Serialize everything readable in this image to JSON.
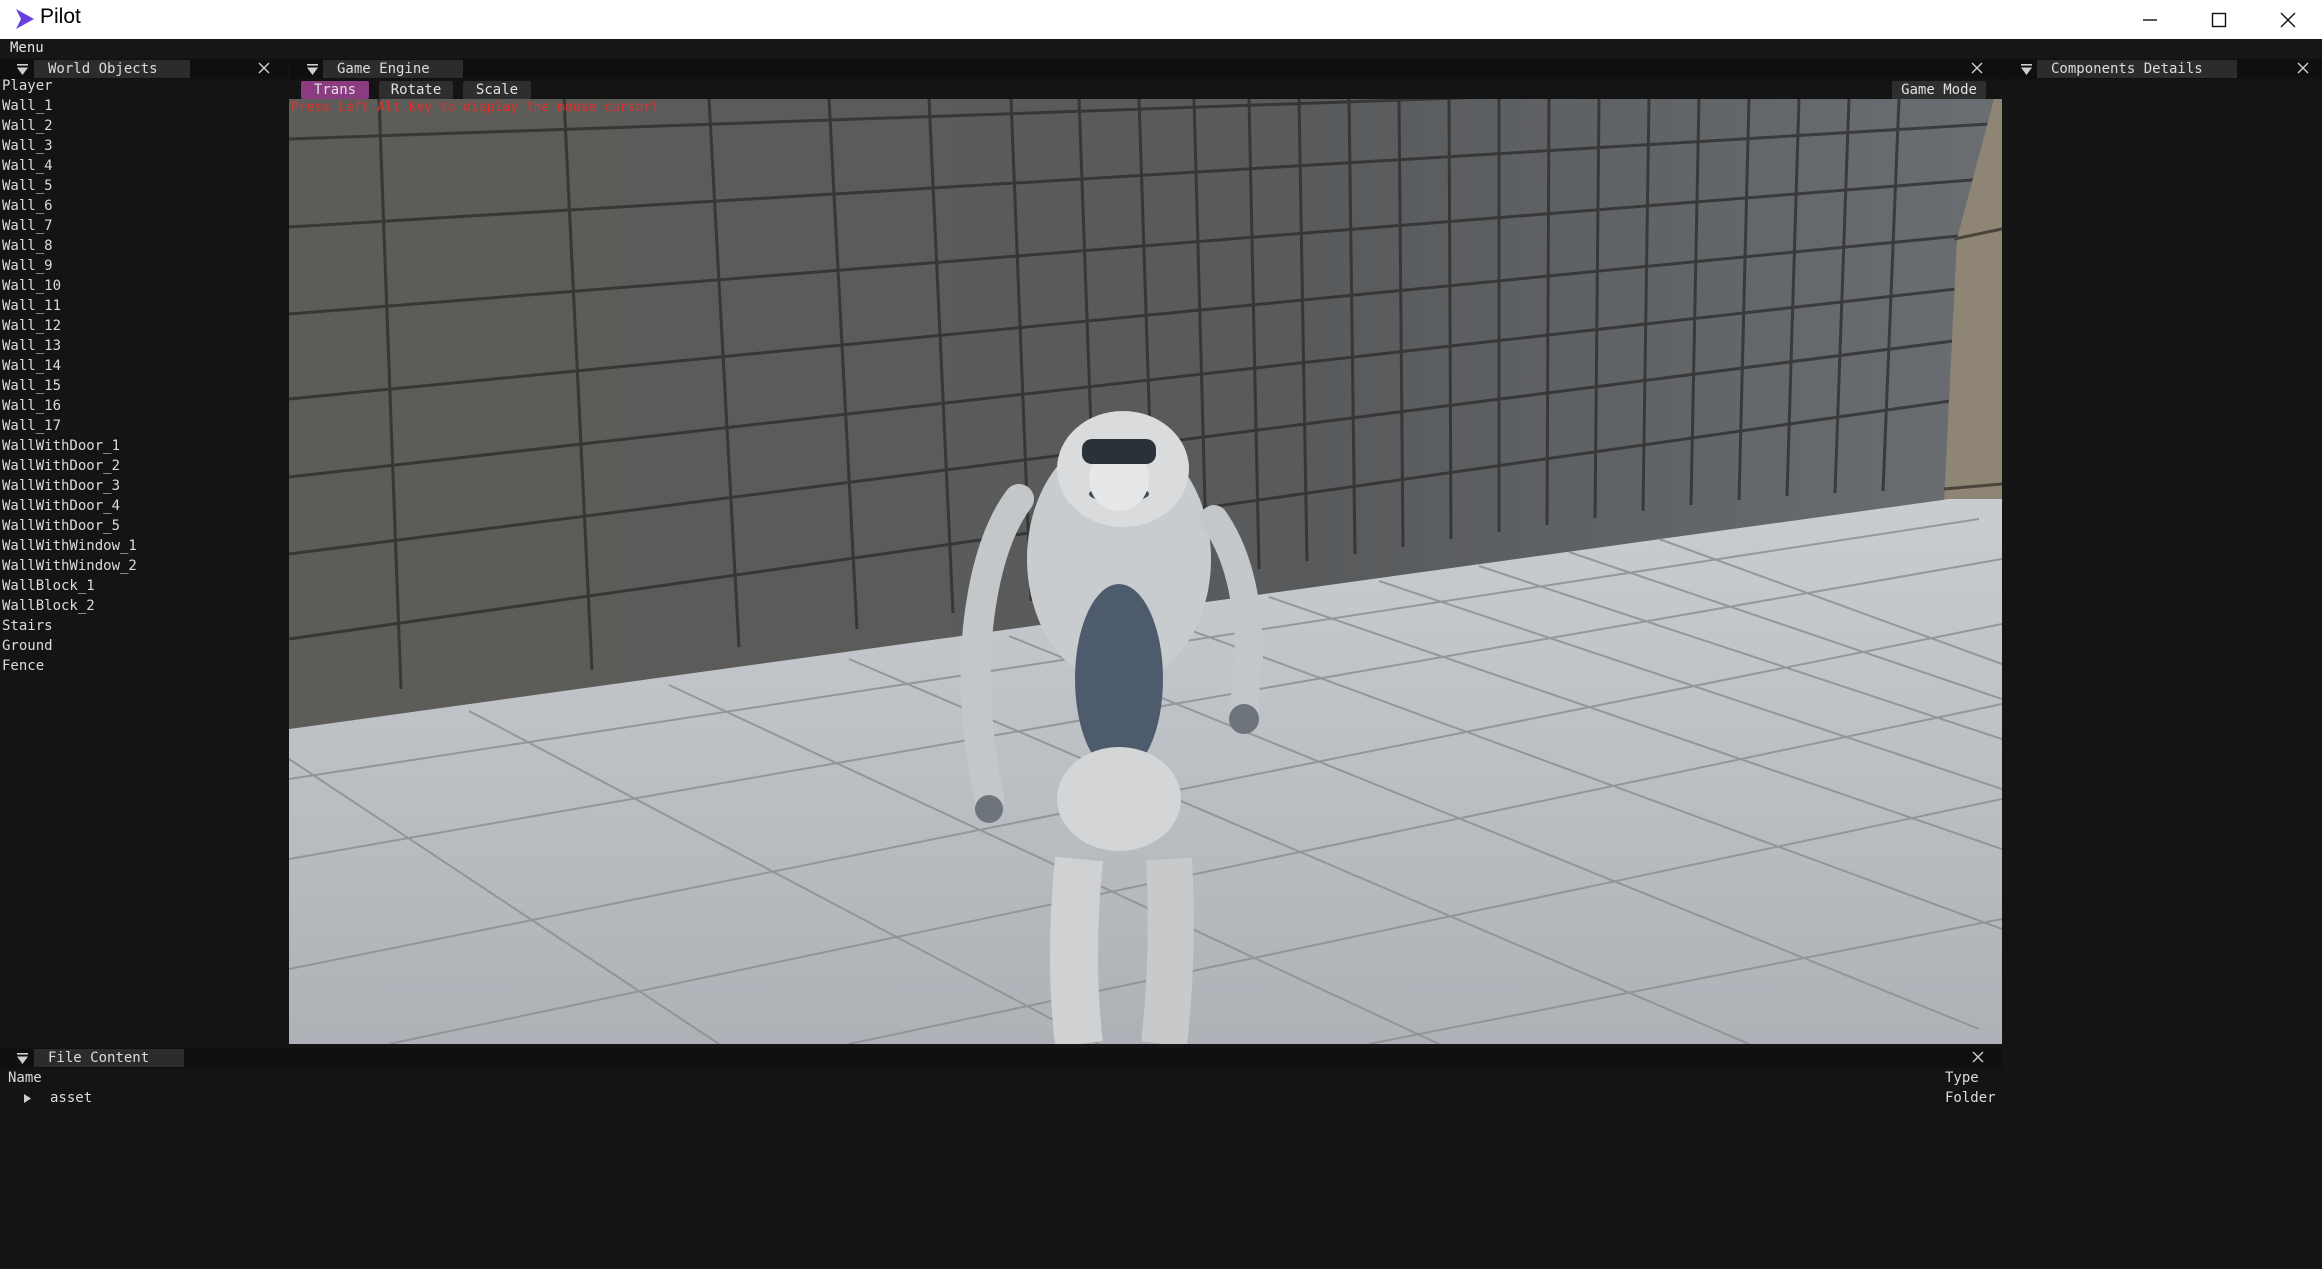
{
  "window": {
    "title": "Pilot"
  },
  "menubar": {
    "menu_label": "Menu"
  },
  "world_objects": {
    "tab_label": "World Objects",
    "items": [
      "Player",
      "Wall_1",
      "Wall_2",
      "Wall_3",
      "Wall_4",
      "Wall_5",
      "Wall_6",
      "Wall_7",
      "Wall_8",
      "Wall_9",
      "Wall_10",
      "Wall_11",
      "Wall_12",
      "Wall_13",
      "Wall_14",
      "Wall_15",
      "Wall_16",
      "Wall_17",
      "WallWithDoor_1",
      "WallWithDoor_2",
      "WallWithDoor_3",
      "WallWithDoor_4",
      "WallWithDoor_5",
      "WallWithWindow_1",
      "WallWithWindow_2",
      "WallBlock_1",
      "WallBlock_2",
      "Stairs",
      "Ground",
      "Fence"
    ]
  },
  "game_engine": {
    "tab_label": "Game Engine",
    "tools": [
      "Trans",
      "Rotate",
      "Scale"
    ],
    "active_tool": "Trans",
    "mode_button": "Game Mode",
    "hint": "Press Left Alt key to display the mouse cursor!"
  },
  "components_details": {
    "tab_label": "Components Details"
  },
  "file_content": {
    "tab_label": "File Content",
    "columns": {
      "name": "Name",
      "type": "Type"
    },
    "rows": [
      {
        "name": "asset",
        "type": "Folder"
      }
    ]
  },
  "colors": {
    "accent_active_tool": "#8b3b80",
    "hint_text": "#e0322c",
    "logo": "#6a3fe0"
  }
}
